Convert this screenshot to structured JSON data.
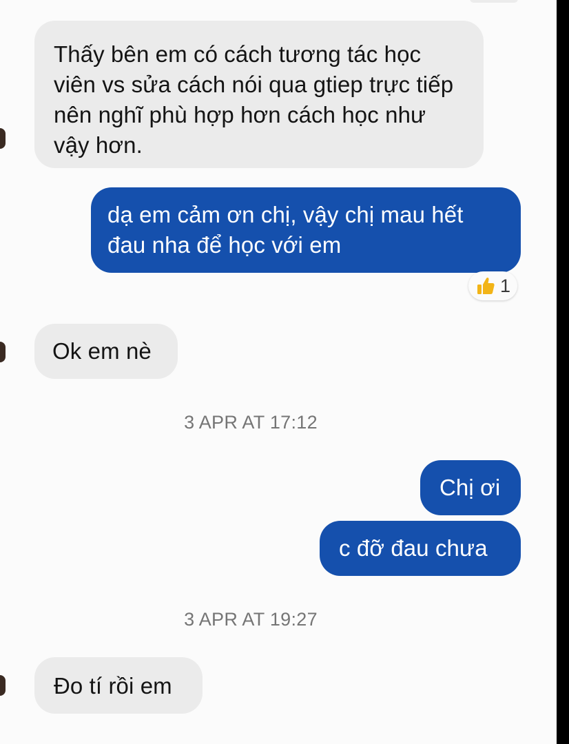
{
  "messages": [
    {
      "direction": "incoming",
      "text": "Thấy bên em có cách tương tác học viên vs sửa cách nói qua gtiep trực tiếp nên nghĩ phù hợp hơn cách học như vậy hơn."
    },
    {
      "direction": "outgoing",
      "text": "dạ em cảm ơn chị, vậy chị mau hết đau nha để học với em",
      "reaction": {
        "icon": "thumbs-up-icon",
        "count": "1"
      }
    },
    {
      "direction": "incoming",
      "text": "Ok em nè"
    },
    {
      "direction": "outgoing",
      "text": "Chị ơi"
    },
    {
      "direction": "outgoing",
      "text": "c đỡ đau chưa"
    },
    {
      "direction": "incoming",
      "text": "Đo tí rồi em"
    }
  ],
  "timestamps": [
    "3 APR AT 17:12",
    "3 APR AT 19:27"
  ],
  "colors": {
    "incoming_bubble": "#ebebeb",
    "outgoing_bubble": "#1550ad",
    "background": "#fbfbfb",
    "timestamp_text": "#757575",
    "reaction_icon": "#f2b417"
  }
}
